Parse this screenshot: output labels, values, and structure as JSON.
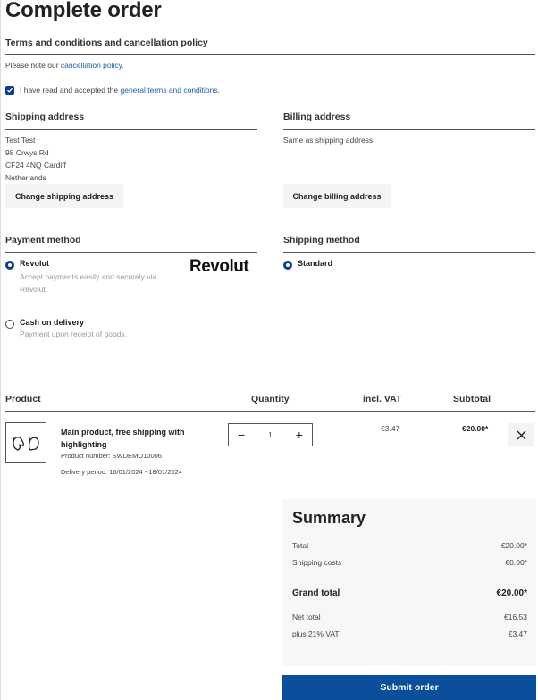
{
  "page": {
    "title": "Complete order"
  },
  "terms": {
    "heading": "Terms and conditions and cancellation policy",
    "note_prefix": "Please note our ",
    "note_link": "cancellation policy",
    "note_suffix": ".",
    "checkbox_prefix": "I have read and accepted the ",
    "checkbox_link": "general terms and conditions",
    "checkbox_suffix": ".",
    "checked": true
  },
  "shipping_address": {
    "heading": "Shipping address",
    "lines": [
      "Test Test",
      "98 Crwys Rd",
      "CF24 4NQ Cardiff",
      "Netherlands"
    ],
    "button": "Change shipping address"
  },
  "billing_address": {
    "heading": "Billing address",
    "line": "Same as shipping address",
    "button": "Change billing address"
  },
  "payment": {
    "heading": "Payment method",
    "options": [
      {
        "label": "Revolut",
        "description": "Accept payments easily and securely via Revolut.",
        "selected": true,
        "logo": "Revolut"
      },
      {
        "label": "Cash on delivery",
        "description": "Payment upon receipt of goods.",
        "selected": false
      }
    ]
  },
  "shipping_method": {
    "heading": "Shipping method",
    "options": [
      {
        "label": "Standard",
        "selected": true
      }
    ]
  },
  "cart": {
    "headers": {
      "product": "Product",
      "quantity": "Quantity",
      "vat": "incl. VAT",
      "subtotal": "Subtotal"
    },
    "items": [
      {
        "name": "Main product, free shipping with highlighting",
        "product_number": "Product number: SWDEMO10006",
        "delivery": "Delivery period: 16/01/2024 - 18/01/2024",
        "quantity": "1",
        "vat": "€3.47",
        "subtotal": "€20.00*",
        "thumbnail_icon": "mittens-icon"
      }
    ],
    "minus": "−",
    "plus": "+",
    "remove": "×"
  },
  "summary": {
    "heading": "Summary",
    "total_label": "Total",
    "total_value": "€20.00*",
    "shipping_label": "Shipping costs",
    "shipping_value": "€0.00*",
    "grand_label": "Grand total",
    "grand_value": "€20.00*",
    "net_label": "Net total",
    "net_value": "€16.53",
    "vat_label": "plus 21% VAT",
    "vat_value": "€3.47"
  },
  "submit": {
    "label": "Submit order"
  },
  "colors": {
    "primary": "#0b4f9c",
    "link": "#1b5fa8"
  }
}
